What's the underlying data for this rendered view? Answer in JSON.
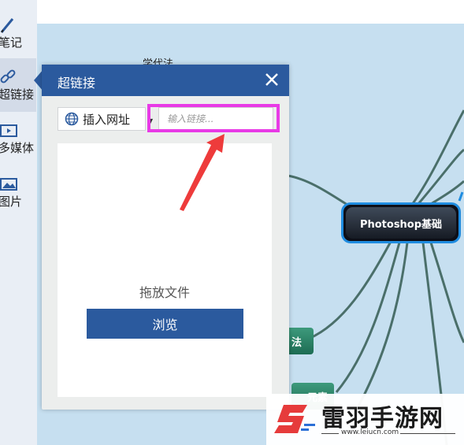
{
  "sidebar": {
    "items": [
      {
        "label": "笔记",
        "icon": "pencil-icon"
      },
      {
        "label": "超链接",
        "icon": "link-icon",
        "active": true
      },
      {
        "label": "多媒体",
        "icon": "film-icon"
      },
      {
        "label": "图片",
        "icon": "image-icon"
      }
    ]
  },
  "canvas": {
    "root_node": "Photoshop基础",
    "partial_labels": [
      "学代法",
      "法",
      "元素"
    ]
  },
  "popup": {
    "title": "超链接",
    "url_type": "插入网址",
    "link_placeholder": "输入链接...",
    "drop_text": "拖放文件",
    "browse_label": "浏览"
  },
  "watermark": {
    "name": "雷羽手游网",
    "url": "www.leiucn.com"
  },
  "colors": {
    "header_blue": "#2b5a9e",
    "highlight_magenta": "#e83ae6",
    "canvas_bg": "#c6dff0",
    "arrow_red": "#ee3b3b"
  }
}
